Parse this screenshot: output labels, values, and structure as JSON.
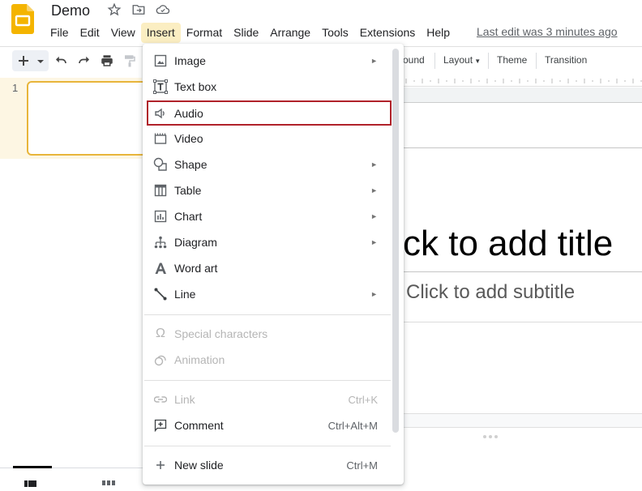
{
  "app": {
    "doc_title": "Demo",
    "brand_color": "#f4b400",
    "header_icons": [
      "star-icon",
      "move-to-folder-icon",
      "cloud-saved-icon"
    ]
  },
  "menubar": {
    "items": [
      {
        "label": "File"
      },
      {
        "label": "Edit"
      },
      {
        "label": "View"
      },
      {
        "label": "Insert",
        "active": true
      },
      {
        "label": "Format"
      },
      {
        "label": "Slide"
      },
      {
        "label": "Arrange"
      },
      {
        "label": "Tools"
      },
      {
        "label": "Extensions"
      },
      {
        "label": "Help"
      }
    ],
    "last_edit": "Last edit was 3 minutes ago"
  },
  "toolbar": {
    "icons": [
      "new-slide-icon",
      "dropdown-icon",
      "undo-icon",
      "redo-icon",
      "print-icon",
      "paint-format-icon"
    ],
    "background_label": "ound",
    "layout_label": "Layout",
    "theme_label": "Theme",
    "transition_label": "Transition"
  },
  "filmstrip": {
    "slide_number": "1",
    "selected_color": "#e8b53a"
  },
  "slide": {
    "title_placeholder": "ck to add title",
    "subtitle_placeholder": "Click to add subtitle"
  },
  "insert_menu": {
    "highlight_color": "#b0222a",
    "items": [
      {
        "label": "Image",
        "icon": "image-icon",
        "submenu": true
      },
      {
        "label": "Text box",
        "icon": "text-box-icon"
      },
      {
        "label": "Audio",
        "icon": "audio-icon",
        "highlighted": true
      },
      {
        "label": "Video",
        "icon": "video-icon"
      },
      {
        "label": "Shape",
        "icon": "shape-icon",
        "submenu": true
      },
      {
        "label": "Table",
        "icon": "table-icon",
        "submenu": true
      },
      {
        "label": "Chart",
        "icon": "chart-icon",
        "submenu": true
      },
      {
        "label": "Diagram",
        "icon": "diagram-icon",
        "submenu": true
      },
      {
        "label": "Word art",
        "icon": "word-art-icon"
      },
      {
        "label": "Line",
        "icon": "line-icon",
        "submenu": true
      },
      {
        "label": "Special characters",
        "icon": "omega-icon",
        "disabled": true
      },
      {
        "label": "Animation",
        "icon": "animation-icon",
        "disabled": true
      },
      {
        "label": "Link",
        "icon": "link-icon",
        "disabled": true,
        "shortcut": "Ctrl+K"
      },
      {
        "label": "Comment",
        "icon": "comment-icon",
        "shortcut": "Ctrl+Alt+M"
      },
      {
        "label": "New slide",
        "icon": "plus-icon",
        "shortcut": "Ctrl+M"
      }
    ],
    "submenu_arrow": "►"
  }
}
